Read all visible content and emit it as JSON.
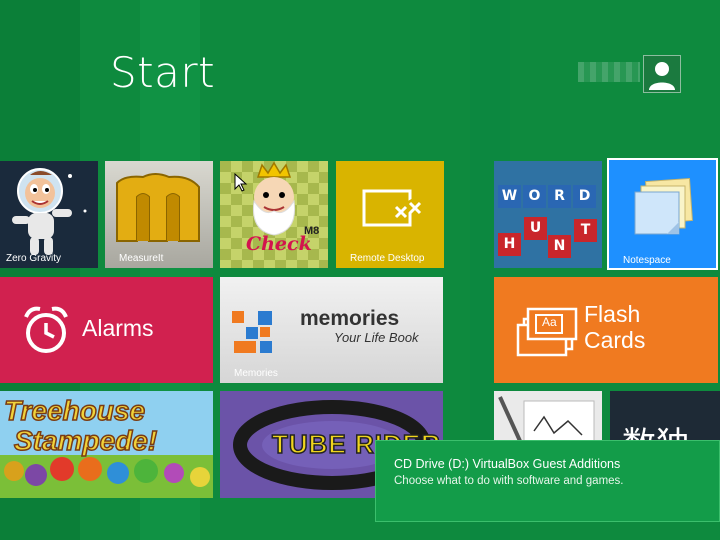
{
  "header": {
    "title": "Start"
  },
  "user": {
    "avatar_icon": "user-icon"
  },
  "tiles": {
    "zero_gravity": "Zero Gravity",
    "measureit": "MeasureIt",
    "checkm8_logo": "Check",
    "checkm8_sup": "M8",
    "remote_desktop": "Remote Desktop",
    "word_hunt_letters": [
      "W",
      "O",
      "R",
      "D",
      "H",
      "U",
      "N",
      "T"
    ],
    "notespace": "Notespace",
    "alarms": "Alarms",
    "memories_brand": "memories",
    "memories_tagline": "Your Life Book",
    "memories_label": "Memories",
    "flash_cards_line1": "Flash",
    "flash_cards_line2": "Cards",
    "flash_icon_text": "Aa",
    "treehouse_line1": "Treehouse",
    "treehouse_line2": "Stampede!",
    "tube_rider": "TUBE RIDER",
    "chinese": "数独"
  },
  "toast": {
    "title": "CD Drive (D:) VirtualBox Guest Additions",
    "message": "Choose what to do with software and games."
  },
  "colors": {
    "background": "#0e8a3e",
    "alarms": "#d1214f",
    "flash_cards": "#f07a20",
    "remote_desktop": "#d9b400",
    "notespace": "#1e90ff",
    "tube_rider": "#6b53a8",
    "toast": "#139c49"
  }
}
